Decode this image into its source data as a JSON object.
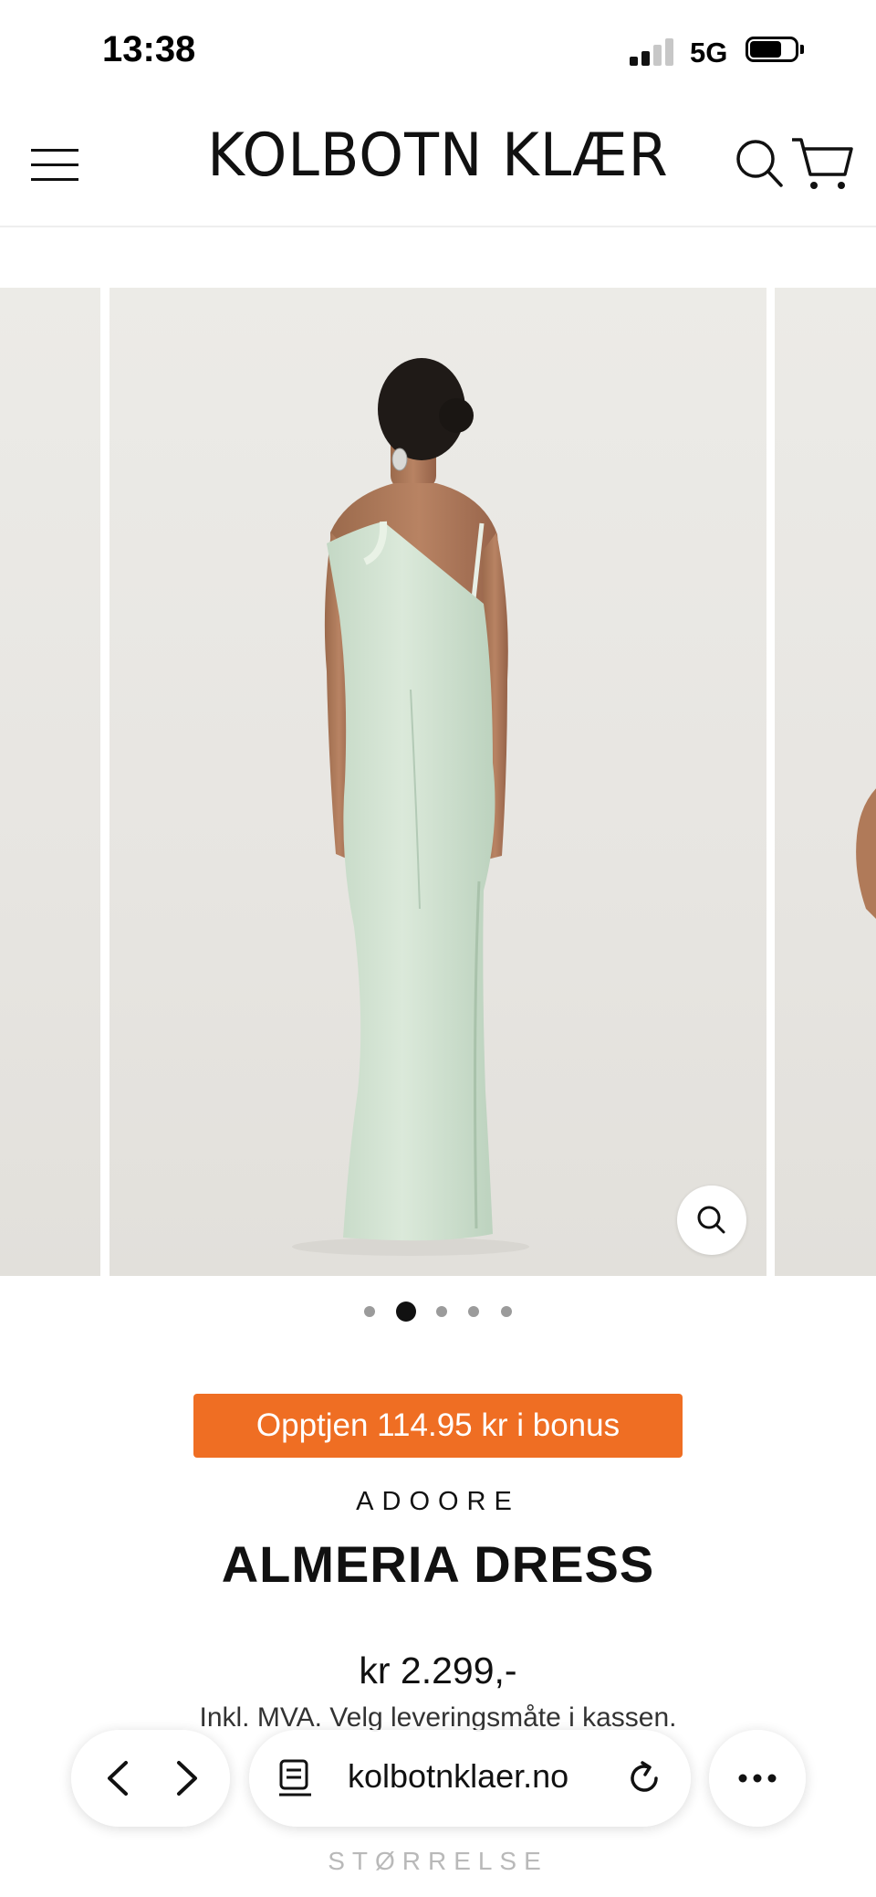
{
  "status_bar": {
    "time": "13:38",
    "network": "5G"
  },
  "header": {
    "logo": "KOLBOTN KLÆR"
  },
  "gallery": {
    "slide_count": 5,
    "active_index": 1
  },
  "product": {
    "bonus_text": "Opptjen 114.95 kr i bonus",
    "vendor": "ADOORE",
    "title": "ALMERIA DRESS",
    "price": "kr 2.299,-",
    "tax_note": "Inkl. MVA. Velg leveringsmåte i kassen.",
    "size_label": "STØRRELSE"
  },
  "browser": {
    "url": "kolbotnklaer.no"
  },
  "colors": {
    "accent": "#ef6e23",
    "dress": "#cfe1cf",
    "background": "#e9e7e3"
  }
}
